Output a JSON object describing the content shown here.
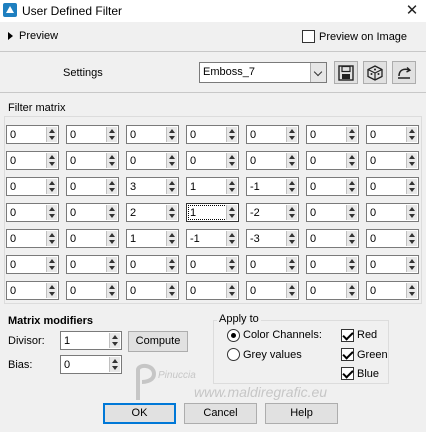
{
  "window": {
    "title": "User Defined Filter",
    "close": "✕"
  },
  "preview": {
    "label": "Preview",
    "on_image_label": "Preview on Image",
    "on_image_checked": false
  },
  "settings": {
    "label": "Settings",
    "preset": "Emboss_7"
  },
  "matrix": {
    "title": "Filter matrix",
    "rows": [
      [
        "0",
        "0",
        "0",
        "0",
        "0",
        "0",
        "0"
      ],
      [
        "0",
        "0",
        "0",
        "0",
        "0",
        "0",
        "0"
      ],
      [
        "0",
        "0",
        "3",
        "1",
        "-1",
        "0",
        "0"
      ],
      [
        "0",
        "0",
        "2",
        "1",
        "-2",
        "0",
        "0"
      ],
      [
        "0",
        "0",
        "1",
        "-1",
        "-3",
        "0",
        "0"
      ],
      [
        "0",
        "0",
        "0",
        "0",
        "0",
        "0",
        "0"
      ],
      [
        "0",
        "0",
        "0",
        "0",
        "0",
        "0",
        "0"
      ]
    ]
  },
  "modifiers": {
    "title": "Matrix modifiers",
    "divisor_label": "Divisor:",
    "divisor": "1",
    "bias_label": "Bias:",
    "bias": "0",
    "compute_label": "Compute"
  },
  "apply": {
    "title": "Apply to",
    "color_channels": "Color Channels:",
    "grey_values": "Grey values",
    "selected": "color_channels",
    "red": "Red",
    "green": "Green",
    "blue": "Blue"
  },
  "buttons": {
    "ok": "OK",
    "cancel": "Cancel",
    "help": "Help"
  },
  "watermark": {
    "name": "Pinuccia",
    "site": "www.maldiregrafic.eu"
  },
  "colors": {
    "focus_border": "#0078d7",
    "title_bg": "#ffffff",
    "window_bg": "#f0f0f0"
  }
}
